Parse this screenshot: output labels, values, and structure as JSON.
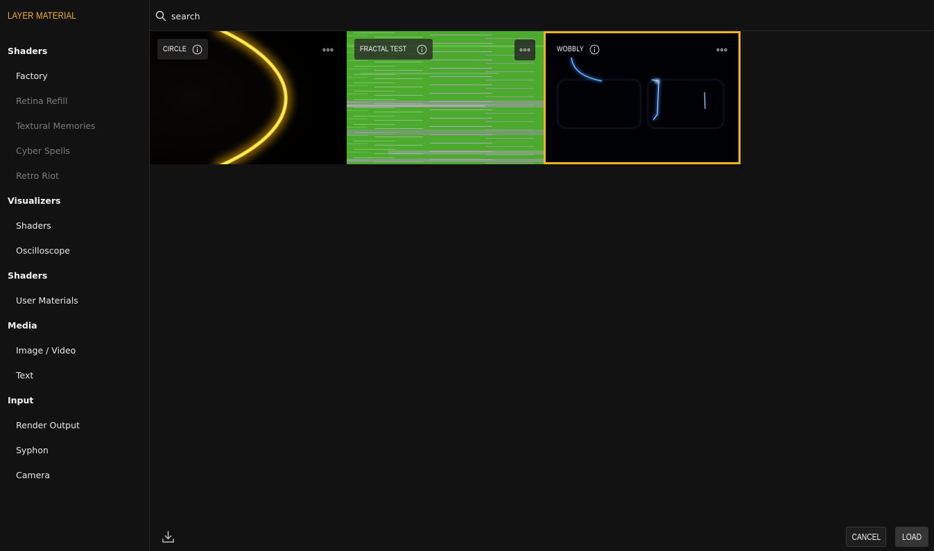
{
  "app": {
    "title": "LAYER MATERIAL"
  },
  "search": {
    "placeholder": "search",
    "icon": "search-icon"
  },
  "sidebar": {
    "groups": [
      {
        "title": "Shaders",
        "items": [
          {
            "label": "Factory",
            "dim": false
          },
          {
            "label": "Retina Refill",
            "dim": true
          },
          {
            "label": "Textural Memories",
            "dim": true
          },
          {
            "label": "Cyber Spells",
            "dim": true
          },
          {
            "label": "Retro Riot",
            "dim": true
          }
        ]
      },
      {
        "title": "Visualizers",
        "items": [
          {
            "label": "Shaders",
            "dim": false
          },
          {
            "label": "Oscilloscope",
            "dim": false
          }
        ]
      },
      {
        "title": "Shaders",
        "items": [
          {
            "label": "User Materials",
            "dim": false
          }
        ]
      },
      {
        "title": "Media",
        "items": [
          {
            "label": "Image / Video",
            "dim": false
          },
          {
            "label": "Text",
            "dim": false
          }
        ]
      },
      {
        "title": "Input",
        "items": [
          {
            "label": "Render Output",
            "dim": false
          },
          {
            "label": "Syphon",
            "dim": false
          },
          {
            "label": "Camera",
            "dim": false
          }
        ]
      }
    ]
  },
  "materials": [
    {
      "title": "CIRCLE",
      "selected": false,
      "thumbnail": "yellow-glowing-arc"
    },
    {
      "title": "FRACTAL TEST",
      "selected": false,
      "thumbnail": "green-purple-noise-stripes"
    },
    {
      "title": "WOBBLY",
      "selected": true,
      "thumbnail": "dark-blue-light-streaks"
    }
  ],
  "footer": {
    "download_icon": "download-icon",
    "cancel_label": "CANCEL",
    "load_label": "LOAD"
  },
  "colors": {
    "accent": "#f0b41e",
    "background": "#121212",
    "dim_text": "#7a7a7a"
  }
}
